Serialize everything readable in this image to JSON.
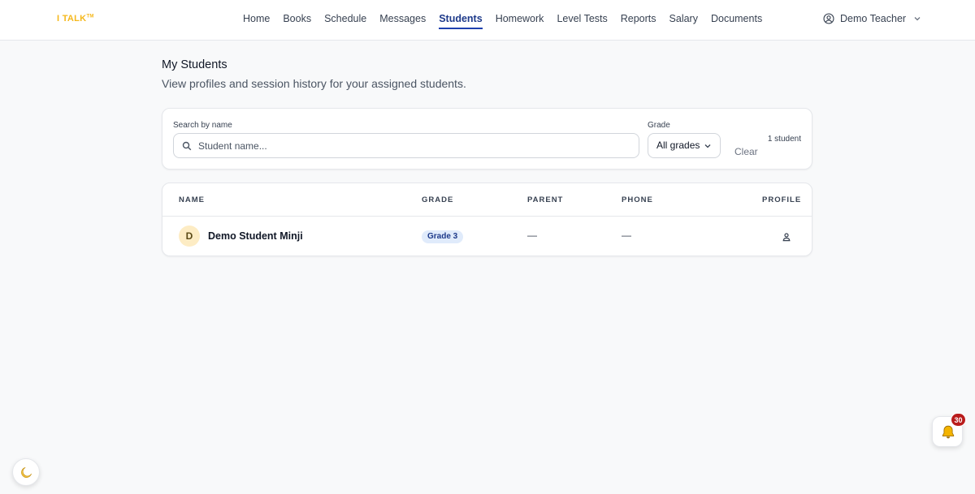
{
  "brand": {
    "logo_text": "I TALK",
    "logo_mark": "TM",
    "accent": "#f5b81c"
  },
  "nav": {
    "items": [
      {
        "label": "Home"
      },
      {
        "label": "Books"
      },
      {
        "label": "Schedule"
      },
      {
        "label": "Messages"
      },
      {
        "label": "Students",
        "active": true
      },
      {
        "label": "Homework"
      },
      {
        "label": "Level Tests"
      },
      {
        "label": "Reports"
      },
      {
        "label": "Salary"
      },
      {
        "label": "Documents"
      }
    ],
    "user_name": "Demo Teacher",
    "user_icon": "user-circle-icon"
  },
  "page": {
    "title": "My Students",
    "subtitle": "View profiles and session history for your assigned students."
  },
  "filters": {
    "search_label": "Search by name",
    "search_placeholder": "Student name...",
    "search_value": "",
    "grade_label": "Grade",
    "grade_selected": "All grades",
    "clear_label": "Clear",
    "count_text": "1 student"
  },
  "table": {
    "headers": {
      "name": "NAME",
      "grade": "GRADE",
      "parent": "PARENT",
      "phone": "PHONE",
      "profile": "PROFILE"
    },
    "rows": [
      {
        "initial": "D",
        "name": "Demo Student Minji",
        "grade": "Grade 3",
        "parent": "—",
        "phone": "—",
        "profile_icon": "person-icon"
      }
    ]
  },
  "notifications": {
    "count": "30",
    "icon": "bell-icon",
    "badge_color": "#b91c1c"
  },
  "theme_toggle": {
    "icon": "moon-icon"
  }
}
